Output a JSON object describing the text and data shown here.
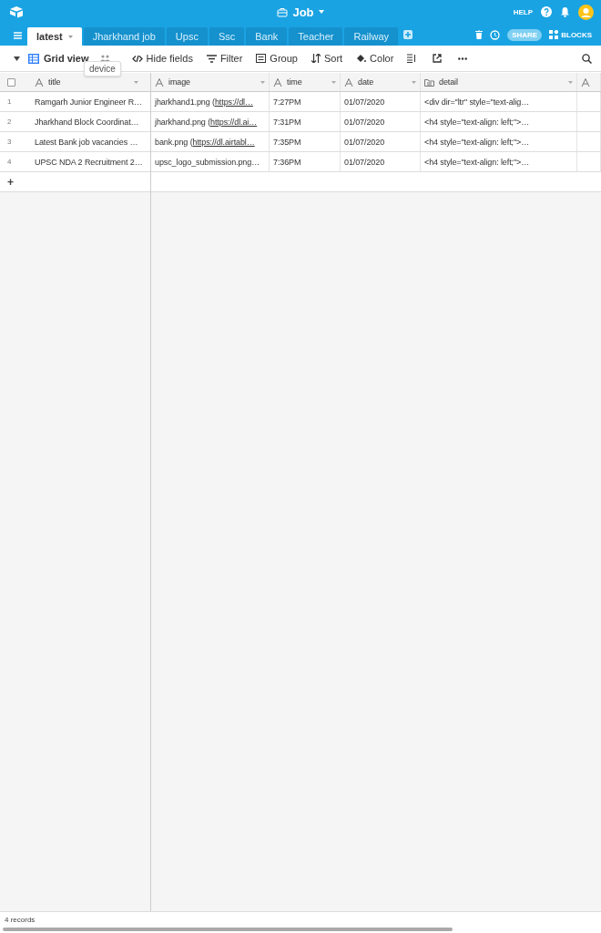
{
  "header": {
    "title": "Job",
    "help": "HELP"
  },
  "tabs": [
    {
      "label": "latest",
      "selected": true
    },
    {
      "label": "Jharkhand job",
      "selected": false
    },
    {
      "label": "Upsc",
      "selected": false
    },
    {
      "label": "Ssc",
      "selected": false
    },
    {
      "label": "Bank",
      "selected": false
    },
    {
      "label": "Teacher",
      "selected": false
    },
    {
      "label": "Railway",
      "selected": false
    }
  ],
  "share": "SHARE",
  "blocks": "BLOCKS",
  "toolbar": {
    "view": "Grid view",
    "tooltip": "device",
    "items": [
      {
        "kind": "hide",
        "label": "Hide fields"
      },
      {
        "kind": "filter",
        "label": "Filter"
      },
      {
        "kind": "group",
        "label": "Group"
      },
      {
        "kind": "sort",
        "label": "Sort"
      },
      {
        "kind": "color",
        "label": "Color"
      }
    ]
  },
  "table": {
    "select_all": {
      "checked": false
    },
    "columns": [
      {
        "label": "title",
        "kind": "text"
      },
      {
        "label": "image",
        "kind": "text"
      },
      {
        "label": "time",
        "kind": "text"
      },
      {
        "label": "date",
        "kind": "text"
      },
      {
        "label": "detail",
        "kind": "long"
      },
      {
        "kind": "text"
      }
    ],
    "rows": [
      {
        "number": "1",
        "title": "Ramgarh Junior Engineer R…",
        "image": {
          "file": "jharkhand1.png (",
          "link": "https://dl…"
        },
        "time": "7:27PM",
        "date": "01/07/2020",
        "detail": "<div dir=\"ltr\" style=\"text-alig…"
      },
      {
        "number": "2",
        "title": "Jharkhand Block Coordinat…",
        "image": {
          "file": "jharkhand.png (",
          "link": "https://dl.ai…"
        },
        "time": "7:31PM",
        "date": "01/07/2020",
        "detail": "<h4 style=\"text-align: left;\">…"
      },
      {
        "number": "3",
        "title": "Latest Bank job vacancies …",
        "image": {
          "file": "bank.png (",
          "link": "https://dl.airtabl…"
        },
        "time": "7:35PM",
        "date": "01/07/2020",
        "detail": "<h4 style=\"text-align: left;\">…"
      },
      {
        "number": "4",
        "title": "UPSC NDA 2 Recruitment 2…",
        "image": {
          "file": "upsc_logo_submission.png…"
        },
        "time": "7:36PM",
        "date": "01/07/2020",
        "detail": "<h4 style=\"text-align: left;\">…"
      }
    ],
    "add": "+"
  },
  "status_bar": "4 records"
}
